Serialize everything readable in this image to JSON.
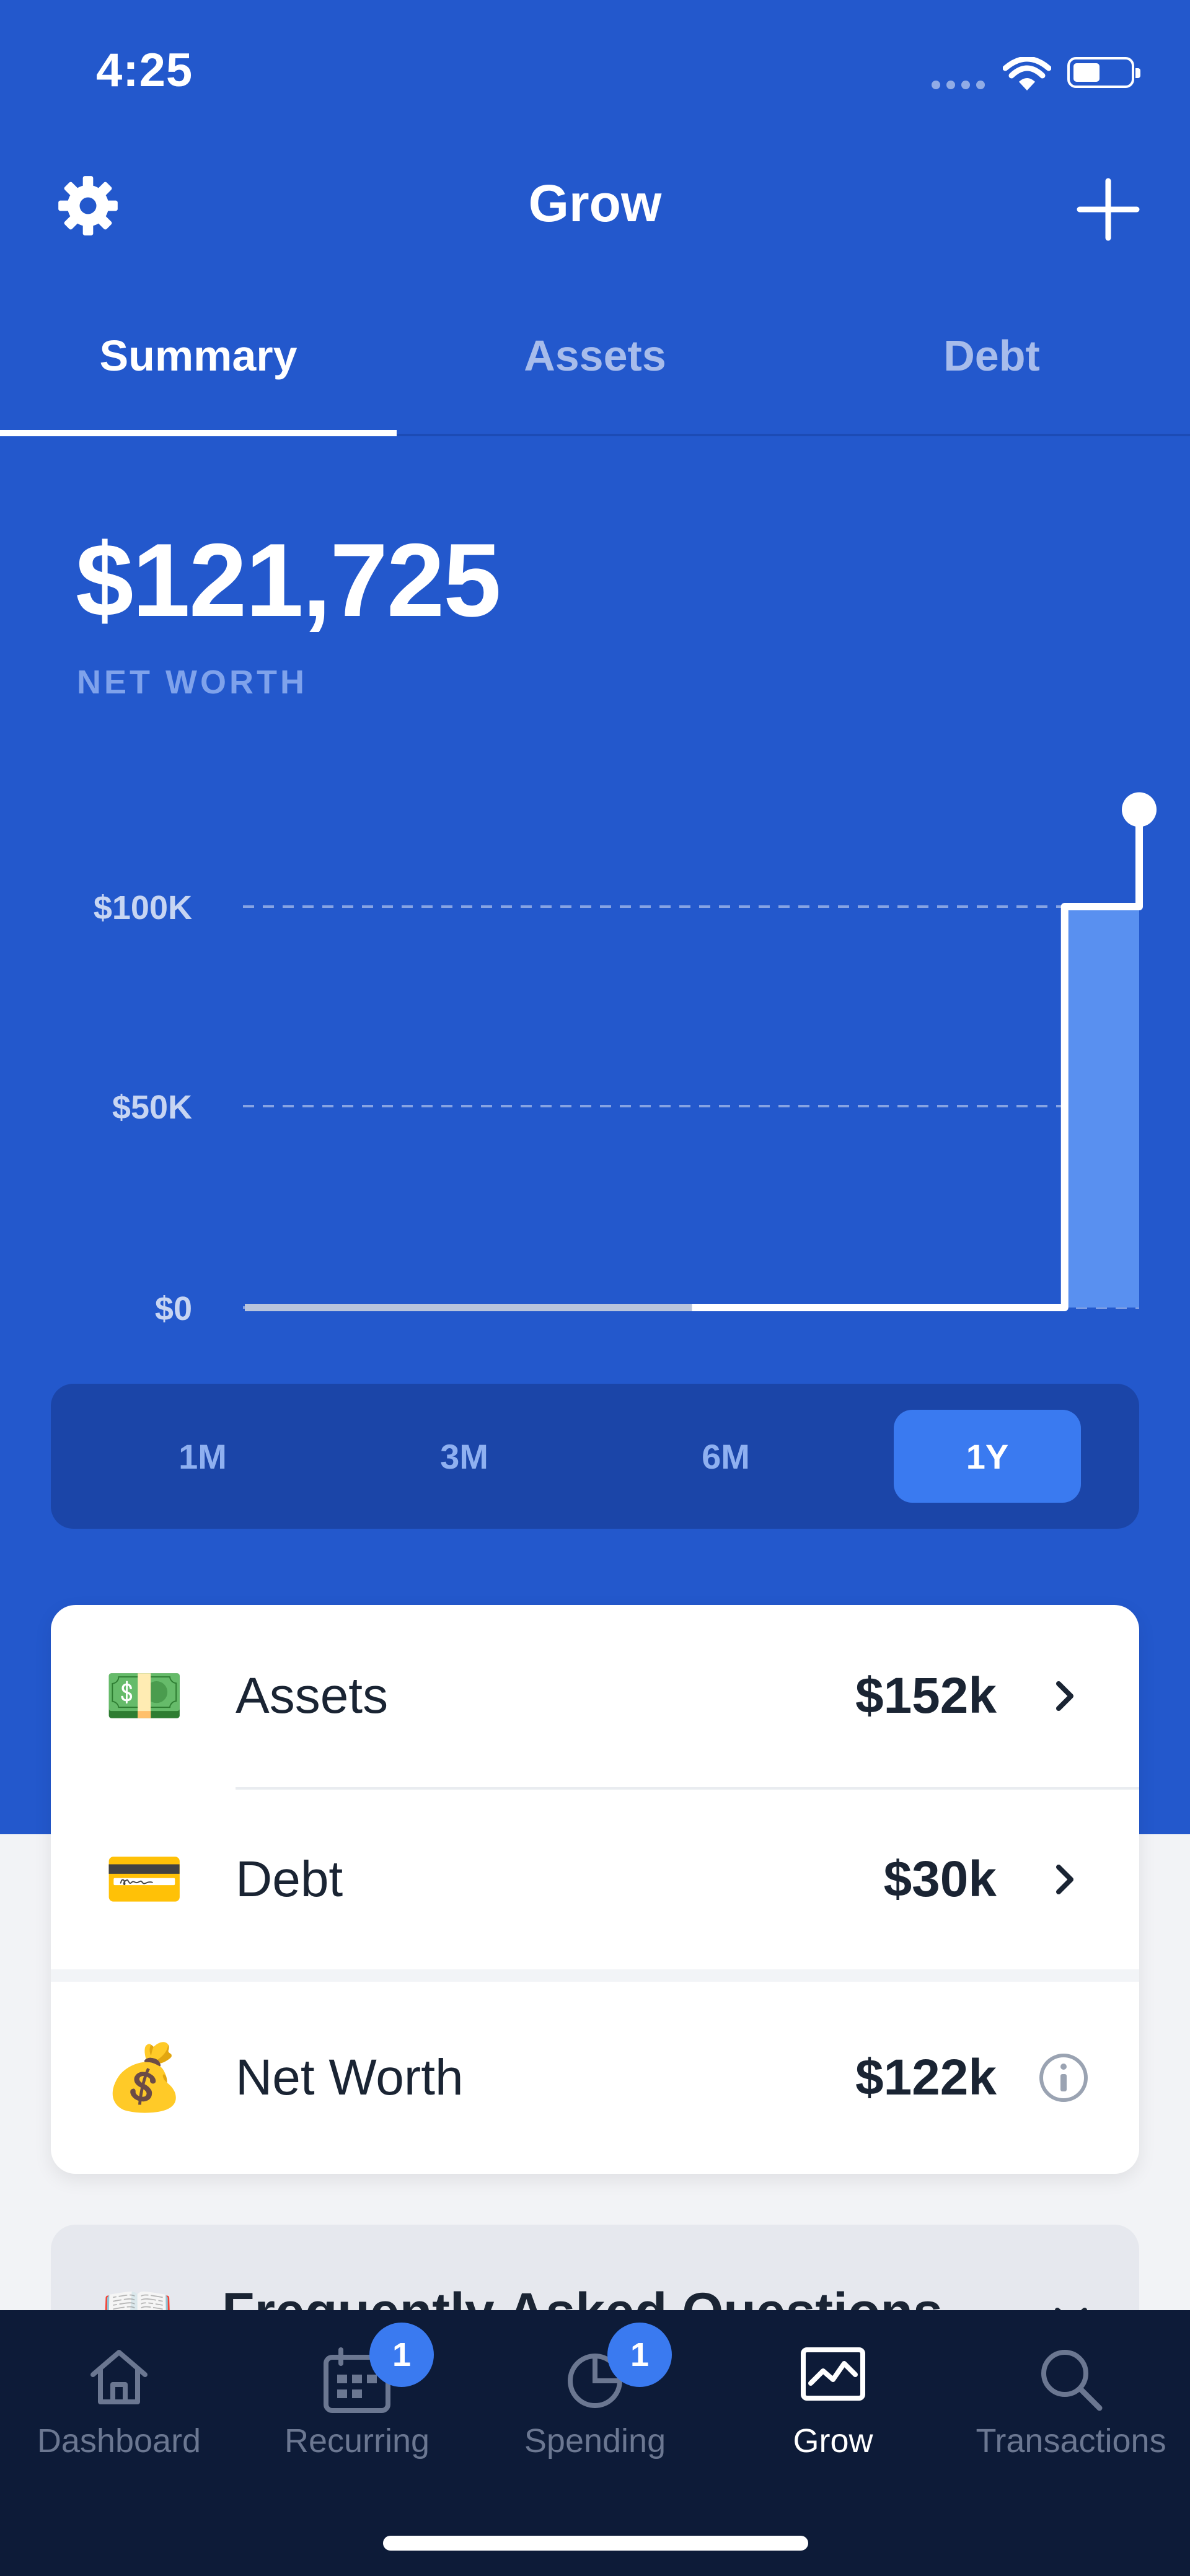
{
  "status_bar": {
    "time": "4:25"
  },
  "header": {
    "title": "Grow",
    "left_icon": "gear-icon",
    "right_icon": "plus-icon"
  },
  "tabs": [
    {
      "label": "Summary",
      "active": true
    },
    {
      "label": "Assets",
      "active": false
    },
    {
      "label": "Debt",
      "active": false
    }
  ],
  "net_worth": {
    "amount": "$121,725",
    "label": "NET WORTH"
  },
  "chart_data": {
    "type": "area",
    "y_ticks": [
      "$100K",
      "$50K",
      "$0"
    ],
    "ylim": [
      0,
      100000
    ],
    "grid": true,
    "series": [
      {
        "values": [
          0,
          0,
          0,
          0,
          0,
          0,
          0,
          0,
          0,
          0,
          0,
          100000,
          121725
        ]
      }
    ]
  },
  "periods": [
    {
      "label": "1M",
      "active": false
    },
    {
      "label": "3M",
      "active": false
    },
    {
      "label": "6M",
      "active": false
    },
    {
      "label": "1Y",
      "active": true
    }
  ],
  "summary": {
    "rows": [
      {
        "emoji": "💵",
        "label": "Assets",
        "value": "$152k",
        "action": "chevron-right-icon"
      },
      {
        "emoji": "💳",
        "label": "Debt",
        "value": "$30k",
        "action": "chevron-right-icon"
      },
      {
        "emoji": "💰",
        "label": "Net Worth",
        "value": "$122k",
        "action": "info-icon"
      }
    ]
  },
  "faq": {
    "emoji": "📖",
    "title": "Frequently Asked Questions"
  },
  "bottom_nav": [
    {
      "label": "Dashboard",
      "icon": "home-icon",
      "badge": ""
    },
    {
      "label": "Recurring",
      "icon": "calendar-icon",
      "badge": "1"
    },
    {
      "label": "Spending",
      "icon": "pie-chart-icon",
      "badge": "1"
    },
    {
      "label": "Grow",
      "icon": "growth-chart-icon",
      "badge": "",
      "active": true
    },
    {
      "label": "Transactions",
      "icon": "search-icon",
      "badge": ""
    }
  ],
  "colors": {
    "primary": "#2358cc",
    "accent": "#3a7af0",
    "nav_bg": "#0d1b38",
    "card_text": "#1a2433"
  }
}
